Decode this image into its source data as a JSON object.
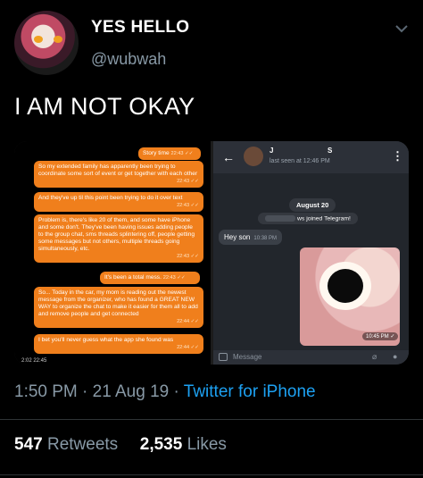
{
  "tweet": {
    "display_name": "YES HELLO",
    "handle": "@wubwah",
    "text": "I AM NOT OKAY",
    "timestamp": "1:50 PM · 21 Aug 19 · ",
    "source": "Twitter for iPhone",
    "retweets_count": "547",
    "retweets_label": "Retweets",
    "likes_count": "2,535",
    "likes_label": "Likes"
  },
  "left_screenshot": {
    "messages": [
      {
        "text": "Story time",
        "time": "22:43 ✓✓"
      },
      {
        "text": "So my extended family has apparently been trying to coordinate some sort of event or get together with each other",
        "time": "22:43 ✓✓"
      },
      {
        "text": "And they've up til this point been trying to do it over text",
        "time": "22:43 ✓✓"
      },
      {
        "text": "Problem is, there's like 20 of them, and some have iPhone and some don't. They've been having issues adding people to the group chat, sms threads splintering off, people getting some messages but not others, multiple threads going simultaneously, etc.",
        "time": "22:43 ✓✓"
      },
      {
        "text": "It's been a total mess.",
        "time": "22:43 ✓✓"
      },
      {
        "text": "So... Today in the car, my mom is reading out the newest message from the organizer, who has found a GREAT NEW WAY to organize the chat to make it easier for them all to add and remove people and get connected",
        "time": "22:44 ✓✓"
      },
      {
        "text": "I bet you'll never guess what the app she found was",
        "time": "22:44 ✓✓"
      }
    ],
    "bottom_time": "2:02  22:45"
  },
  "right_screenshot": {
    "contact_initial": "J",
    "contact_suffix": "S",
    "last_seen": "last seen at 12:46 PM",
    "date_badge": "August 20",
    "joined_text": "ws joined Telegram!",
    "incoming_message": "Hey son",
    "incoming_time": "10:38 PM",
    "image_time": "10:45 PM ✓",
    "input_placeholder": "Message"
  }
}
